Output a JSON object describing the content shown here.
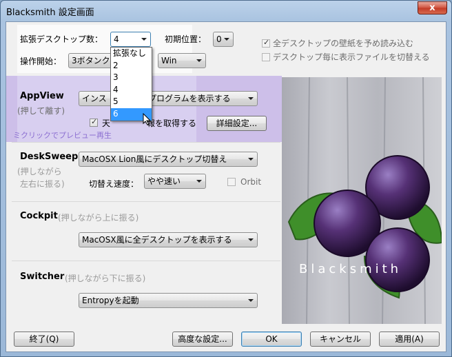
{
  "window": {
    "title": "Blacksmith 設定画面",
    "close_glyph": "x"
  },
  "top": {
    "desktops_label": "拡張デスクトップ数：",
    "desktops_value": "4",
    "initial_pos_label": "初期位置：",
    "initial_pos_value": "0",
    "start_label": "操作開始：",
    "start_value": "3ボタンクリック",
    "start_mod_value": "Win",
    "preload_label": "全デスクトップの壁紙を予め読み込む",
    "preload_checked": true,
    "switch_files_label": "デスクトップ毎に表示ファイルを切替える",
    "switch_files_checked": false
  },
  "dropdown": {
    "options": [
      "拡張なし",
      "2",
      "3",
      "4",
      "5",
      "6"
    ],
    "selected_index": 5
  },
  "appview": {
    "title": "AppView",
    "subtitle": "(押して離す)",
    "action_value": "インストールプログラムを表示する",
    "action_prefix": "インス",
    "action_suffix": "プログラムを表示する",
    "checkbox_label_visible": "天気情報を取得する",
    "checkbox_label_left": "天",
    "checkbox_label_right": "報を取得する",
    "checkbox_checked": true,
    "details_button": "詳細設定...",
    "hint": "ダブルクリックでプレビュー再生",
    "hint_visible": "ミクリックでプレビュー再生"
  },
  "desksweep": {
    "title": "DeskSweep",
    "subtitle1": "(押しながら",
    "subtitle2": "左右に振る)",
    "action_value": "MacOSX Lion風にデスクトップ切替え",
    "speed_label": "切替え速度：",
    "speed_value": "やや速い",
    "orbit_label": "Orbit",
    "orbit_checked": false
  },
  "cockpit": {
    "title": "Cockpit",
    "subtitle": "(押しながら上に振る)",
    "action_value": "MacOSX風に全デスクトップを表示する"
  },
  "switcher": {
    "title": "Switcher",
    "subtitle": "(押しながら下に振る)",
    "action_value": "Entropyを起動"
  },
  "brand": {
    "text": "Blacksmith"
  },
  "footer": {
    "quit": "終了(Q)",
    "advanced": "高度な設定...",
    "ok": "OK",
    "cancel": "キャンセル",
    "apply": "適用(A)"
  },
  "colors": {
    "appview_highlight": "#cdbfe9",
    "selection": "#3399ff",
    "brand_wood": "#b9bbc2",
    "berry": "#4b2a6b",
    "leaf": "#3f8f2a"
  }
}
